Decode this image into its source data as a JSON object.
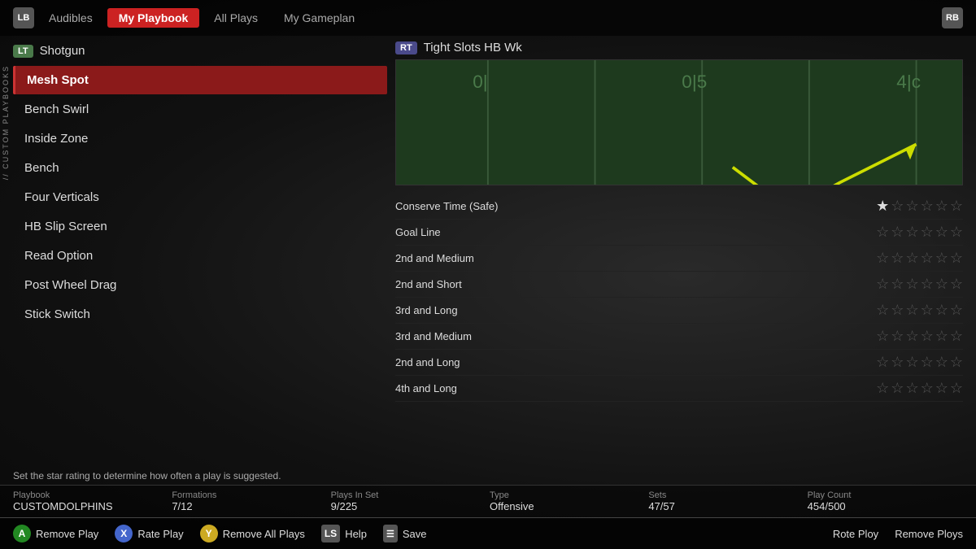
{
  "nav": {
    "lb_label": "LB",
    "rb_label": "RB",
    "items": [
      {
        "label": "Audibles",
        "active": false
      },
      {
        "label": "My Playbook",
        "active": true
      },
      {
        "label": "All Plays",
        "active": false
      },
      {
        "label": "My Gameplan",
        "active": false
      }
    ]
  },
  "sidebar_vertical_label": "// CUSTOM PLAYBOOKS",
  "left_panel": {
    "formation_badge": "LT",
    "formation_name": "Shotgun",
    "plays": [
      {
        "label": "Mesh Spot",
        "selected": true
      },
      {
        "label": "Bench Swirl",
        "selected": false
      },
      {
        "label": "Inside Zone",
        "selected": false
      },
      {
        "label": "Bench",
        "selected": false
      },
      {
        "label": "Four Verticals",
        "selected": false
      },
      {
        "label": "HB Slip Screen",
        "selected": false
      },
      {
        "label": "Read Option",
        "selected": false
      },
      {
        "label": "Post Wheel Drag",
        "selected": false
      },
      {
        "label": "Stick Switch",
        "selected": false
      }
    ]
  },
  "right_panel": {
    "formation_badge": "RT",
    "formation_name": "Tight Slots HB Wk",
    "ratings": [
      {
        "label": "Conserve Time (Safe)",
        "filled": 1,
        "total": 6
      },
      {
        "label": "Goal Line",
        "filled": 0,
        "total": 6
      },
      {
        "label": "2nd and Medium",
        "filled": 0,
        "total": 6
      },
      {
        "label": "2nd and Short",
        "filled": 0,
        "total": 6
      },
      {
        "label": "3rd and Long",
        "filled": 0,
        "total": 6
      },
      {
        "label": "3rd and Medium",
        "filled": 0,
        "total": 6
      },
      {
        "label": "2nd and Long",
        "filled": 0,
        "total": 6
      },
      {
        "label": "4th and Long",
        "filled": 0,
        "total": 6
      }
    ]
  },
  "hint_text": "Set the star rating to determine how often a play is suggested.",
  "stats": [
    {
      "label": "Playbook",
      "value": "CUSTOMDOLPHINS"
    },
    {
      "label": "Formations",
      "value": "7/12"
    },
    {
      "label": "Plays In Set",
      "value": "9/225"
    },
    {
      "label": "Type",
      "value": "Offensive"
    },
    {
      "label": "Sets",
      "value": "47/57"
    },
    {
      "label": "Play Count",
      "value": "454/500"
    }
  ],
  "bottom_bar": {
    "actions": [
      {
        "badge_type": "a",
        "badge_label": "A",
        "label": "Remove Play"
      },
      {
        "badge_type": "x",
        "badge_label": "X",
        "label": "Rate Play"
      },
      {
        "badge_type": "y",
        "badge_label": "Y",
        "label": "Remove All Plays"
      },
      {
        "badge_type": "ls",
        "badge_label": "LS",
        "label": "Help"
      },
      {
        "badge_type": "menu",
        "badge_label": "☰",
        "label": "Save"
      }
    ],
    "rote_ploy": "Rote Ploy",
    "remove_ploys": "Remove Ploys"
  }
}
